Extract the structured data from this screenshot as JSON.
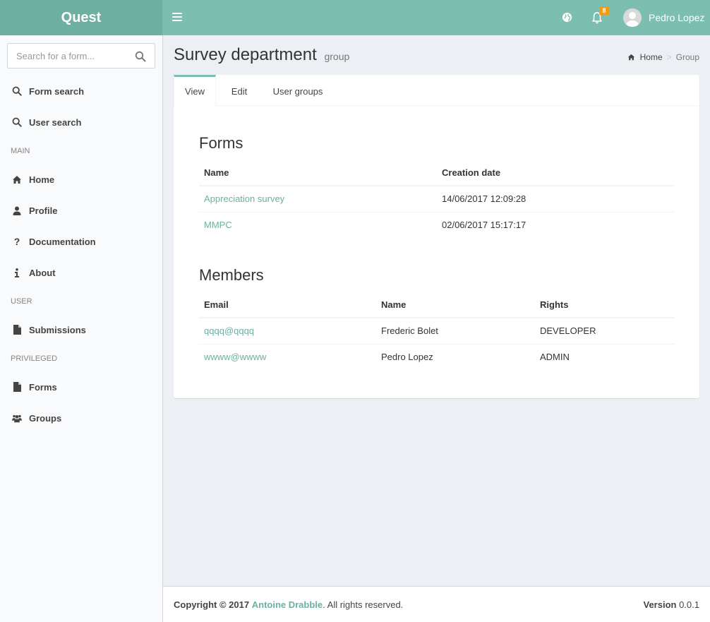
{
  "header": {
    "logo": "Quest",
    "notifications_count": "8",
    "user_name": "Pedro Lopez"
  },
  "sidebar": {
    "search_placeholder": "Search for a form...",
    "top_items": [
      {
        "label": "Form search",
        "icon": "search-icon"
      },
      {
        "label": "User search",
        "icon": "search-icon"
      }
    ],
    "sections": [
      {
        "header": "MAIN",
        "items": [
          {
            "label": "Home",
            "icon": "home-icon"
          },
          {
            "label": "Profile",
            "icon": "user-icon"
          },
          {
            "label": "Documentation",
            "icon": "question-icon"
          },
          {
            "label": "About",
            "icon": "info-icon"
          }
        ]
      },
      {
        "header": "USER",
        "items": [
          {
            "label": "Submissions",
            "icon": "file-icon"
          }
        ]
      },
      {
        "header": "PRIVILEGED",
        "items": [
          {
            "label": "Forms",
            "icon": "file-icon"
          },
          {
            "label": "Groups",
            "icon": "users-icon"
          }
        ]
      }
    ]
  },
  "page": {
    "title": "Survey department",
    "subtitle": "group",
    "breadcrumb": {
      "home": "Home",
      "current": "Group"
    }
  },
  "tabs": [
    "View",
    "Edit",
    "User groups"
  ],
  "forms": {
    "title": "Forms",
    "columns": [
      "Name",
      "Creation date"
    ],
    "rows": [
      {
        "name": "Appreciation survey",
        "date": "14/06/2017 12:09:28"
      },
      {
        "name": "MMPC",
        "date": "02/06/2017 15:17:17"
      }
    ]
  },
  "members": {
    "title": "Members",
    "columns": [
      "Email",
      "Name",
      "Rights"
    ],
    "rows": [
      {
        "email": "qqqq@qqqq",
        "name": "Frederic Bolet",
        "rights": "DEVELOPER"
      },
      {
        "email": "wwww@wwww",
        "name": "Pedro Lopez",
        "rights": "ADMIN"
      }
    ]
  },
  "footer": {
    "copyright": "Copyright © 2017",
    "author": "Antoine Drabble",
    "rights": ". All rights reserved.",
    "version_label": "Version",
    "version": "0.0.1"
  },
  "colors": {
    "accent": "#7cbfb0",
    "logo_bg": "#6db0a2",
    "link": "#6db0a2",
    "badge": "#f39c12",
    "body_bg": "#ecf0f5"
  }
}
